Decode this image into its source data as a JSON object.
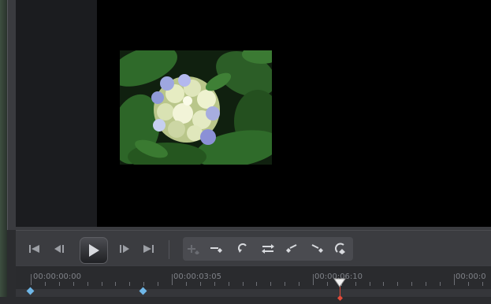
{
  "player": {
    "controls": {
      "go_start": "go-to-start",
      "prev_frame": "previous-frame",
      "play": "play",
      "next_frame": "next-frame",
      "go_end": "go-to-end"
    },
    "edit_tools": [
      "add-keyframe",
      "remove-keyframe",
      "rotate",
      "swap",
      "previous-keyframe",
      "next-keyframe",
      "duplicate-keyframe"
    ]
  },
  "timeline": {
    "timecodes": [
      "00:00:00:00",
      "00:00:03:05",
      "00:00:06:10",
      "00:00:0"
    ],
    "playhead_timecode": "00:00:06:10"
  },
  "colors": {
    "keyframe_marker": "#6fb7e8",
    "playhead_line": "#e24b3a",
    "background": "#2b2c2f"
  }
}
